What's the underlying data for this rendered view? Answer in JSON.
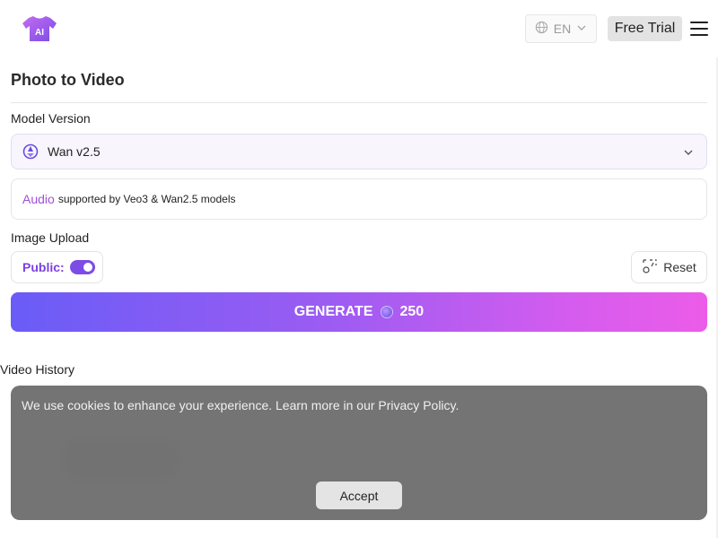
{
  "header": {
    "logo_text": "AI",
    "language": "EN",
    "free_trial_label": "Free Trial"
  },
  "page_title": "Photo to Video",
  "model": {
    "label": "Model Version",
    "selected": "Wan v2.5"
  },
  "audio_note": {
    "highlight": "Audio",
    "text": "supported by Veo3 & Wan2.5 models"
  },
  "upload": {
    "label": "Image Upload",
    "public_label": "Public:",
    "public_on": true,
    "reset_label": "Reset"
  },
  "generate": {
    "label": "GENERATE",
    "credits": "250"
  },
  "history": {
    "label": "Video History"
  },
  "cookie": {
    "message": "We use cookies to enhance your experience. Learn more in our Privacy Policy.",
    "accept_label": "Accept"
  },
  "colors": {
    "accent_purple": "#7b3fe4",
    "audio_purple": "#a14fd9",
    "gradient_start": "#6a5cf7",
    "gradient_end": "#ec5ce8"
  },
  "icons": [
    "tshirt-logo-icon",
    "globe-icon",
    "chevron-down-icon",
    "menu-icon",
    "model-icon",
    "reset-icon",
    "credit-icon"
  ]
}
